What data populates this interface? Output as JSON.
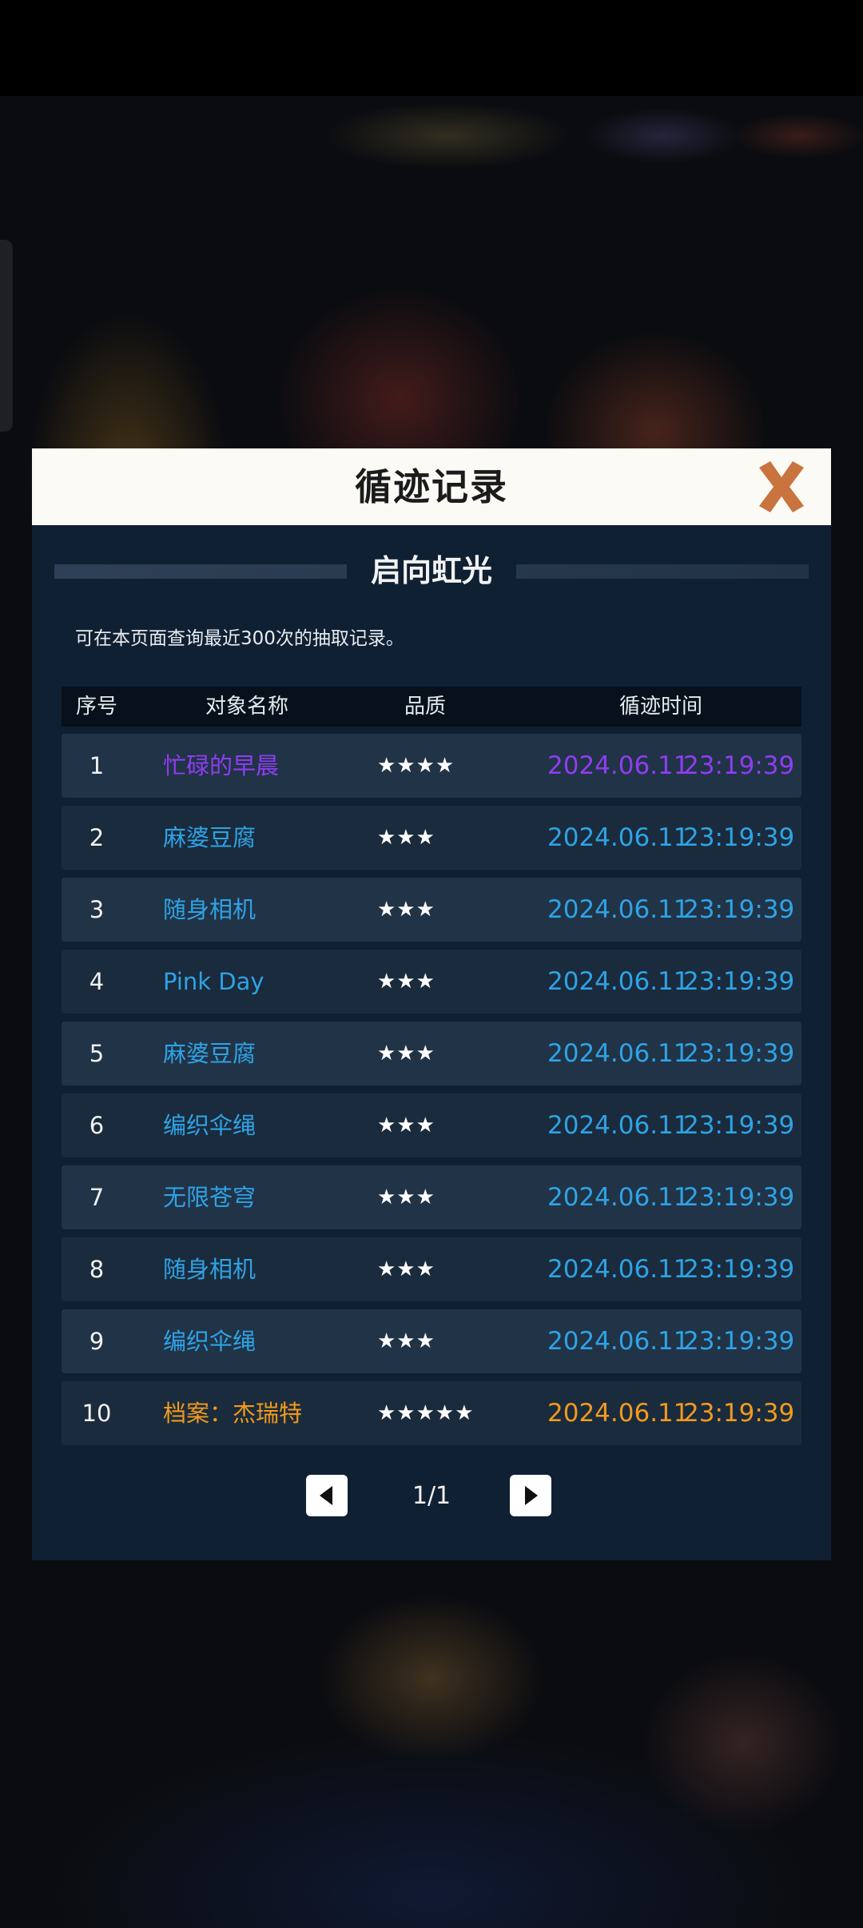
{
  "dialog": {
    "title": "循迹记录",
    "banner": "启向虹光",
    "note": "可在本页面查询最近300次的抽取记录。"
  },
  "table": {
    "headers": [
      "序号",
      "对象名称",
      "品质",
      "循迹时间"
    ],
    "rows": [
      {
        "index": "1",
        "name": "忙碌的早晨",
        "stars": "★★★★",
        "date": "2024.06.11",
        "time": "23:19:39",
        "color": "#8f3df2"
      },
      {
        "index": "2",
        "name": "麻婆豆腐",
        "stars": "★★★",
        "date": "2024.06.11",
        "time": "23:19:39",
        "color": "#2ea3e6"
      },
      {
        "index": "3",
        "name": "随身相机",
        "stars": "★★★",
        "date": "2024.06.11",
        "time": "23:19:39",
        "color": "#2ea3e6"
      },
      {
        "index": "4",
        "name": "Pink Day",
        "stars": "★★★",
        "date": "2024.06.11",
        "time": "23:19:39",
        "color": "#2ea3e6"
      },
      {
        "index": "5",
        "name": "麻婆豆腐",
        "stars": "★★★",
        "date": "2024.06.11",
        "time": "23:19:39",
        "color": "#2ea3e6"
      },
      {
        "index": "6",
        "name": "编织伞绳",
        "stars": "★★★",
        "date": "2024.06.11",
        "time": "23:19:39",
        "color": "#2ea3e6"
      },
      {
        "index": "7",
        "name": "无限苍穹",
        "stars": "★★★",
        "date": "2024.06.11",
        "time": "23:19:39",
        "color": "#2ea3e6"
      },
      {
        "index": "8",
        "name": "随身相机",
        "stars": "★★★",
        "date": "2024.06.11",
        "time": "23:19:39",
        "color": "#2ea3e6"
      },
      {
        "index": "9",
        "name": "编织伞绳",
        "stars": "★★★",
        "date": "2024.06.11",
        "time": "23:19:39",
        "color": "#2ea3e6"
      },
      {
        "index": "10",
        "name": "档案：杰瑞特",
        "stars": "★★★★★",
        "date": "2024.06.11",
        "time": "23:19:39",
        "color": "#f29a1c"
      }
    ]
  },
  "pager": {
    "page": "1/1"
  },
  "colors": {
    "dialog_bg": "#0f2033",
    "header_bg": "#fbfaf5",
    "close_icon": "#c9733e",
    "rarity_3": "#2ea3e6",
    "rarity_4": "#8f3df2",
    "rarity_5": "#f29a1c"
  },
  "icons": {
    "close": "close-x-icon",
    "prev": "triangle-left-icon",
    "next": "triangle-right-icon"
  }
}
